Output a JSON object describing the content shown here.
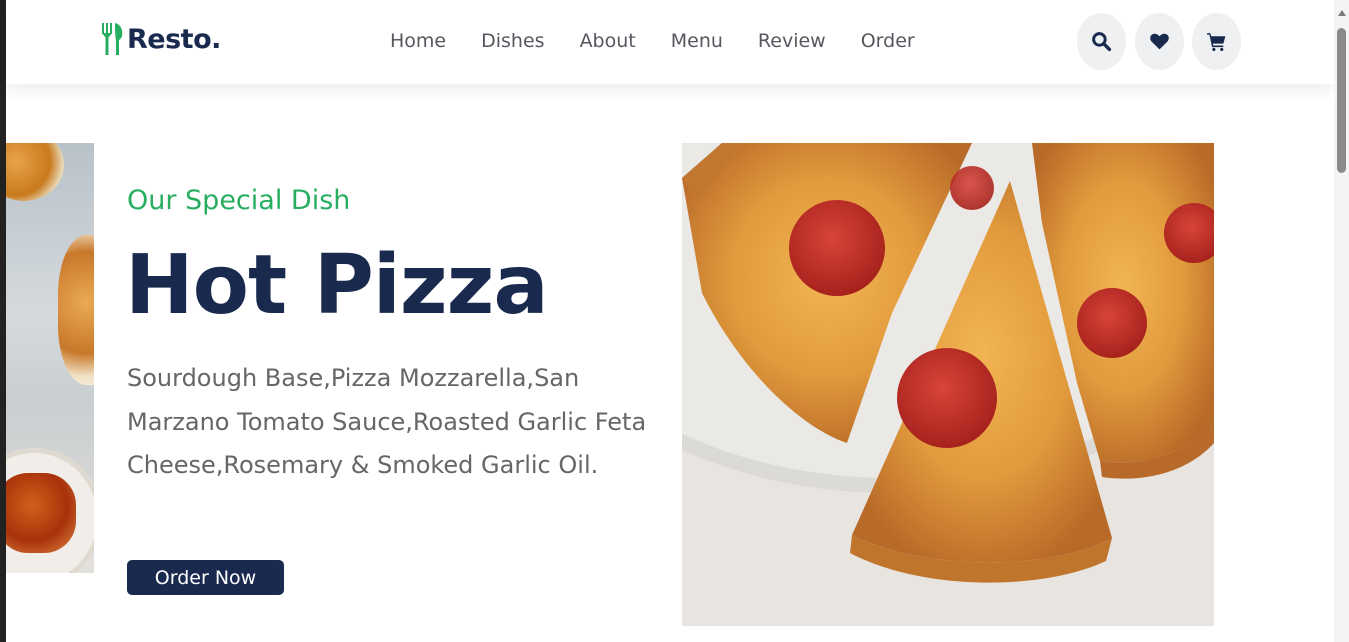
{
  "brand": {
    "name": "Resto."
  },
  "nav": {
    "links": [
      {
        "label": "Home"
      },
      {
        "label": "Dishes"
      },
      {
        "label": "About"
      },
      {
        "label": "Menu"
      },
      {
        "label": "Review"
      },
      {
        "label": "Order"
      }
    ]
  },
  "header_icons": [
    "search-icon",
    "heart-icon",
    "cart-icon"
  ],
  "hero": {
    "subtitle": "Our Special Dish",
    "title": "Hot Pizza",
    "description": "Sourdough Base,Pizza Mozzarella,San Marzano Tomato Sauce,Roasted Garlic Feta Cheese,Rosemary & Smoked Garlic Oil.",
    "button_label": "Order Now"
  },
  "colors": {
    "primary": "#1a2a4f",
    "accent": "#27ae60",
    "icon_bg": "#eef0f2",
    "text_gray": "#666666"
  }
}
